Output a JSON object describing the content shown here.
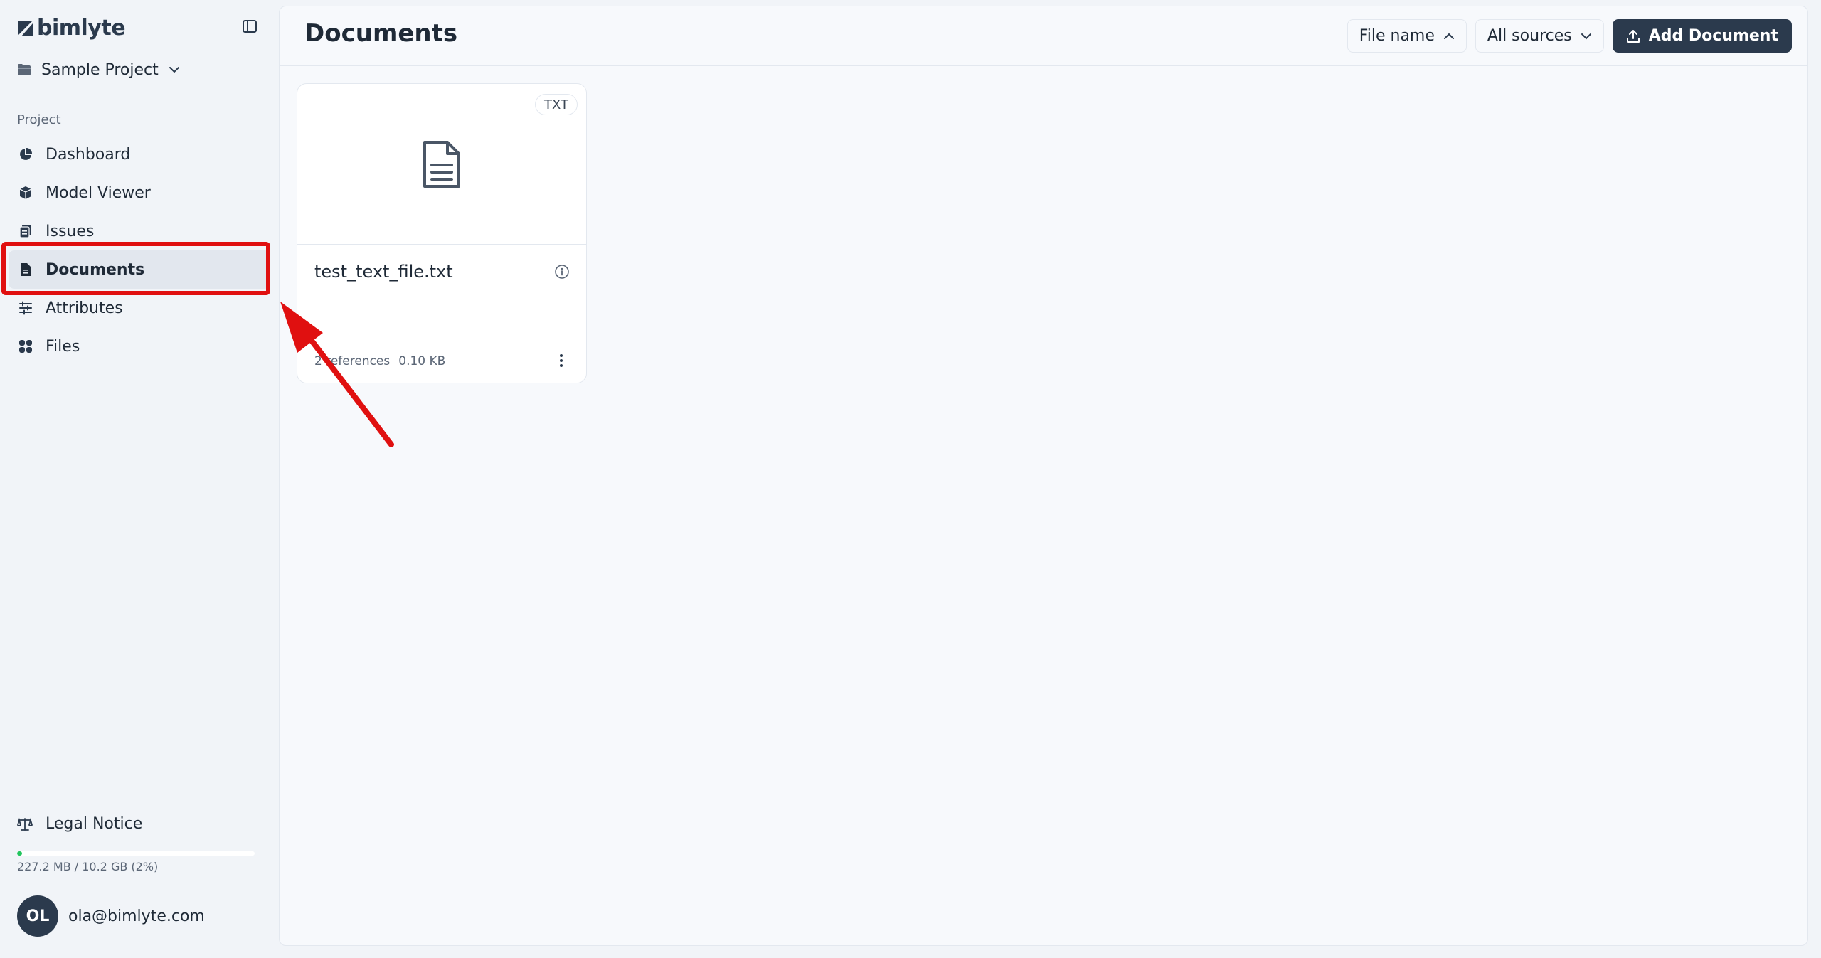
{
  "brand": {
    "name": "bimlyte"
  },
  "project": {
    "name": "Sample Project"
  },
  "sidebar": {
    "section_label": "Project",
    "items": [
      {
        "label": "Dashboard",
        "icon": "pie-chart-icon"
      },
      {
        "label": "Model Viewer",
        "icon": "cube-icon"
      },
      {
        "label": "Issues",
        "icon": "clipboard-icon"
      },
      {
        "label": "Documents",
        "icon": "document-icon",
        "active": true
      },
      {
        "label": "Attributes",
        "icon": "sliders-icon"
      },
      {
        "label": "Files",
        "icon": "grid-icon"
      }
    ],
    "legal_label": "Legal Notice",
    "storage": {
      "text": "227.2 MB / 10.2 GB (2%)",
      "percent": 2
    },
    "user": {
      "initials": "OL",
      "email": "ola@bimlyte.com"
    }
  },
  "main": {
    "title": "Documents",
    "toolbar": {
      "sort_label": "File name",
      "source_label": "All sources",
      "add_label": "Add Document"
    },
    "documents": [
      {
        "name": "test_text_file.txt",
        "type": "TXT",
        "references": "2 references",
        "size": "0.10 KB"
      }
    ]
  },
  "colors": {
    "primary": "#2b3a4d",
    "background": "#f1f4f8",
    "highlight": "#e01010",
    "storage": "#22c55e"
  }
}
